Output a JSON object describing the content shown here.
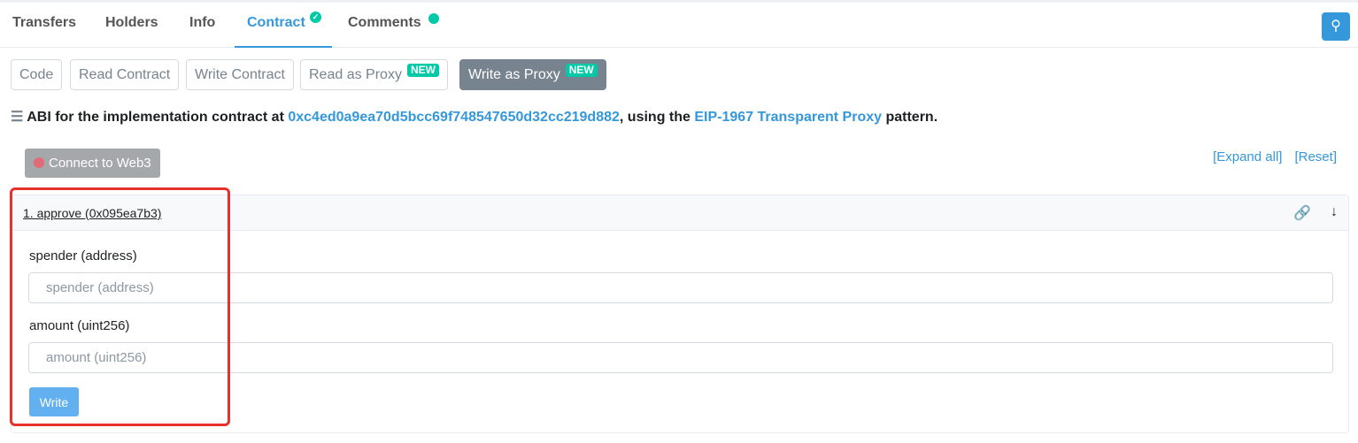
{
  "tabs": [
    {
      "label": "Transfers"
    },
    {
      "label": "Holders"
    },
    {
      "label": "Info"
    },
    {
      "label": "Contract",
      "verified": true
    },
    {
      "label": "Comments",
      "badge": true
    }
  ],
  "active_tab": "Contract",
  "search_icon": "search-icon",
  "subtabs": [
    {
      "label": "Code"
    },
    {
      "label": "Read Contract"
    },
    {
      "label": "Write Contract"
    },
    {
      "label": "Read as Proxy",
      "badge": "NEW"
    },
    {
      "label": "Write as Proxy",
      "badge": "NEW"
    }
  ],
  "abi": {
    "prefix": "ABI for the implementation contract at",
    "address": "0xc4ed0a9ea70d5bcc69f748547650d32cc219d882",
    "middle": ", using the",
    "pattern": "EIP-1967 Transparent Proxy",
    "suffix": "pattern."
  },
  "connect_label": "Connect to Web3",
  "expand_all": "[Expand all]",
  "reset": "[Reset]",
  "function": {
    "title": "1. approve (0x095ea7b3)",
    "inputs": [
      {
        "label": "spender (address)",
        "placeholder": "spender (address)"
      },
      {
        "label": "amount (uint256)",
        "placeholder": "amount (uint256)"
      }
    ],
    "write_label": "Write"
  },
  "colors": {
    "accent": "#3498db",
    "badge": "#00c9a7",
    "highlight": "#e8302c"
  }
}
